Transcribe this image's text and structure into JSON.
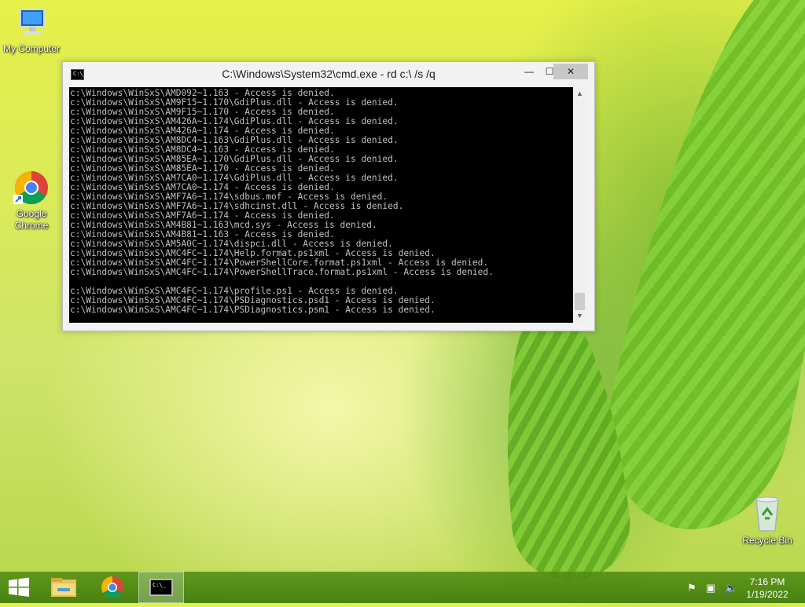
{
  "desktop": {
    "icons": [
      {
        "label": "My Computer"
      },
      {
        "label": "Google Chrome"
      },
      {
        "label": "Recycle Bin"
      }
    ]
  },
  "window": {
    "title": "C:\\Windows\\System32\\cmd.exe - rd  c:\\ /s /q",
    "icon_text": "C:\\_",
    "controls": {
      "minimize": "—",
      "maximize": "☐",
      "close": "✕"
    }
  },
  "console": {
    "lines": [
      "c:\\Windows\\WinSxS\\AMD092~1.163 - Access is denied.",
      "c:\\Windows\\WinSxS\\AM9F15~1.170\\GdiPlus.dll - Access is denied.",
      "c:\\Windows\\WinSxS\\AM9F15~1.170 - Access is denied.",
      "c:\\Windows\\WinSxS\\AM426A~1.174\\GdiPlus.dll - Access is denied.",
      "c:\\Windows\\WinSxS\\AM426A~1.174 - Access is denied.",
      "c:\\Windows\\WinSxS\\AM8DC4~1.163\\GdiPlus.dll - Access is denied.",
      "c:\\Windows\\WinSxS\\AM8DC4~1.163 - Access is denied.",
      "c:\\Windows\\WinSxS\\AM85EA~1.170\\GdiPlus.dll - Access is denied.",
      "c:\\Windows\\WinSxS\\AM85EA~1.170 - Access is denied.",
      "c:\\Windows\\WinSxS\\AM7CA0~1.174\\GdiPlus.dll - Access is denied.",
      "c:\\Windows\\WinSxS\\AM7CA0~1.174 - Access is denied.",
      "c:\\Windows\\WinSxS\\AMF7A6~1.174\\sdbus.mof - Access is denied.",
      "c:\\Windows\\WinSxS\\AMF7A6~1.174\\sdhcinst.dll - Access is denied.",
      "c:\\Windows\\WinSxS\\AMF7A6~1.174 - Access is denied.",
      "c:\\Windows\\WinSxS\\AM4B81~1.163\\mcd.sys - Access is denied.",
      "c:\\Windows\\WinSxS\\AM4B81~1.163 - Access is denied.",
      "c:\\Windows\\WinSxS\\AM5A0C~1.174\\dispci.dll - Access is denied.",
      "c:\\Windows\\WinSxS\\AMC4FC~1.174\\Help.format.ps1xml - Access is denied.",
      "c:\\Windows\\WinSxS\\AMC4FC~1.174\\PowerShellCore.format.ps1xml - Access is denied.",
      "c:\\Windows\\WinSxS\\AMC4FC~1.174\\PowerShellTrace.format.ps1xml - Access is denied.",
      "",
      "c:\\Windows\\WinSxS\\AMC4FC~1.174\\profile.ps1 - Access is denied.",
      "c:\\Windows\\WinSxS\\AMC4FC~1.174\\PSDiagnostics.psd1 - Access is denied.",
      "c:\\Windows\\WinSxS\\AMC4FC~1.174\\PSDiagnostics.psm1 - Access is denied."
    ]
  },
  "scrollbar": {
    "up": "▲",
    "down": "▼"
  },
  "taskbar": {
    "clock_time": "7:16 PM",
    "clock_date": "1/19/2022",
    "cmd_icon_text": "C:\\_"
  }
}
